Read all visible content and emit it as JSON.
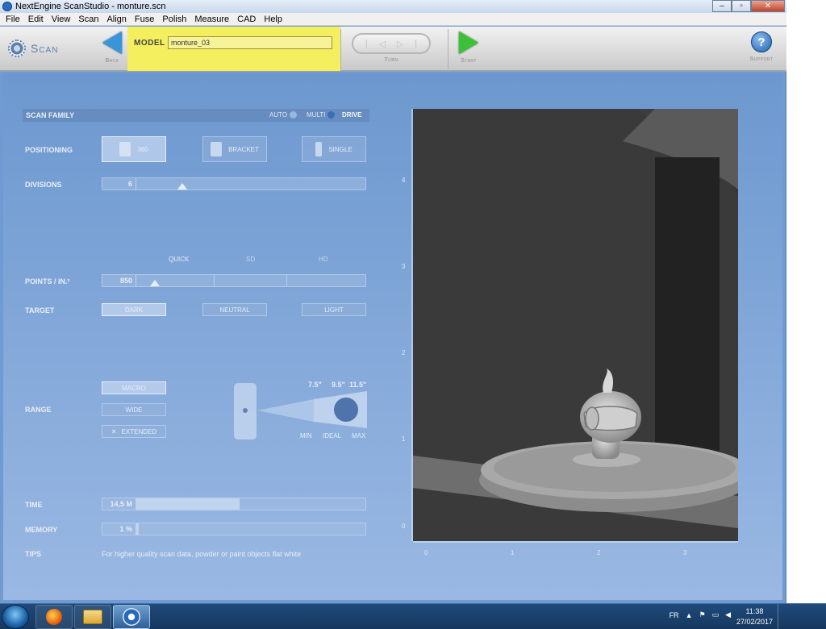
{
  "window": {
    "title": "NextEngine ScanStudio - monture.scn",
    "minimize": "–",
    "maximize": "▫",
    "close": "✕"
  },
  "menu": [
    "File",
    "Edit",
    "View",
    "Scan",
    "Align",
    "Fuse",
    "Polish",
    "Measure",
    "CAD",
    "Help"
  ],
  "toolbar": {
    "scan_label": "Scan",
    "back_label": "Back",
    "model_label": "MODEL",
    "model_value": "monture_03",
    "turn_label": "Turn",
    "turn_glyphs": [
      "|",
      "◁",
      "▷",
      "|"
    ],
    "start_label": "Start",
    "support_label": "Support",
    "help_glyph": "?"
  },
  "scan_family": {
    "title": "SCAN FAMILY",
    "options": [
      "AUTO",
      "MULTI",
      "DRIVE"
    ],
    "selected": "DRIVE"
  },
  "positioning": {
    "label": "POSITIONING",
    "options": [
      "360",
      "BRACKET",
      "SINGLE"
    ],
    "selected": "360"
  },
  "divisions": {
    "label": "DIVISIONS",
    "value": "6",
    "level": 0.2
  },
  "quality": {
    "levels": [
      "QUICK",
      "SD",
      "HD"
    ]
  },
  "points": {
    "label": "POINTS / IN.²",
    "value": "850",
    "level": 0.08
  },
  "target": {
    "label": "TARGET",
    "options": [
      "DARK",
      "NEUTRAL",
      "LIGHT"
    ],
    "selected": "DARK"
  },
  "range": {
    "label": "RANGE",
    "options": [
      "MACRO",
      "WIDE",
      "EXTENDED"
    ],
    "selected": "MACRO",
    "extended_glyph": "✕",
    "distances": [
      "7.5\"",
      "9.5\"",
      "11.5\""
    ],
    "markers": [
      "MIN",
      "IDEAL",
      "MAX"
    ]
  },
  "time": {
    "label": "TIME",
    "value": "14,5 M",
    "level": 0.45
  },
  "memory": {
    "label": "MEMORY",
    "value": "1 %",
    "level": 0.01
  },
  "tips": {
    "label": "TIPS",
    "text": "For higher quality scan data, powder or paint objects flat white"
  },
  "camera": {
    "y_ticks": [
      "4",
      "3",
      "2",
      "1",
      "0"
    ],
    "x_ticks": [
      "0",
      "1",
      "2",
      "3"
    ]
  },
  "taskbar": {
    "lang": "FR",
    "time": "11:38",
    "date": "27/02/2017",
    "tray_up": "▲",
    "tray_flag": "⚑",
    "tray_net": "▭",
    "tray_vol": "◀"
  }
}
